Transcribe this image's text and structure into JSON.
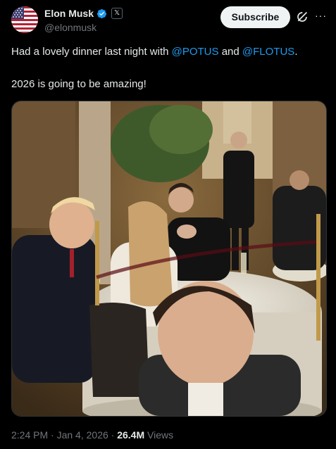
{
  "author": {
    "display_name": "Elon Musk",
    "handle": "@elonmusk",
    "verified_color": "#1d9bf0",
    "affiliate_badge": "𝕏"
  },
  "actions": {
    "subscribe_label": "Subscribe",
    "more_label": "···"
  },
  "tweet": {
    "line1_prefix": "Had a lovely dinner last night with ",
    "mention_1": "@POTUS",
    "line1_mid": " and ",
    "mention_2": "@FLOTUS",
    "line1_suffix": ".",
    "line2": "2026 is going to be amazing!"
  },
  "photo": {
    "description_icon": "dinner-photo"
  },
  "meta": {
    "time": "2:24 PM",
    "separator": " · ",
    "date": "Jan 4, 2026",
    "views_count": "26.4M",
    "views_label": " Views"
  },
  "colors": {
    "background": "#000000",
    "text": "#e7e9ea",
    "secondary": "#71767b",
    "link": "#1d9bf0"
  }
}
